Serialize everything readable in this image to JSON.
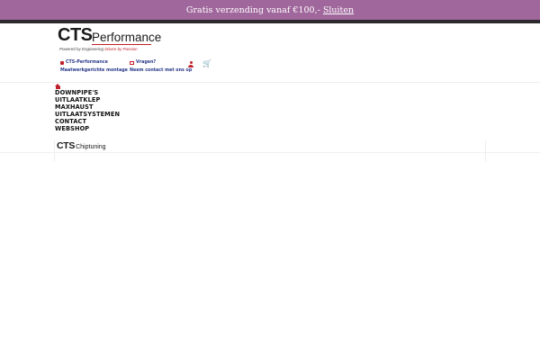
{
  "promo": {
    "text": "Gratis verzending vanaf €100,-",
    "close_label": "Sluiten"
  },
  "logo": {
    "brand": "CTS",
    "name": "Performance",
    "tagline_a": "Powered by Engineering",
    "tagline_b": "Driven by Passion"
  },
  "info1": {
    "line1": "CTS-Performance",
    "line2": "Maatwerkgerichte montage"
  },
  "info2": {
    "line1": "Vragen?",
    "line2": "Neem contact met ons op"
  },
  "icons": {
    "home": "home-icon",
    "user": "user-icon",
    "cart": "cart-icon",
    "mail": "mail-icon",
    "car": "car-icon"
  },
  "nav": {
    "items": [
      "DOWNPIPE'S",
      "UITLAATKLEP",
      "MAXHAUST",
      "UITLAATSYSTEMEN",
      "CONTACT",
      "WEBSHOP"
    ]
  },
  "chiptuning": {
    "brand": "CTS",
    "name": "Chiptuning"
  },
  "colors": {
    "promo_bg": "#a0679c",
    "accent": "#c0202a",
    "info_text": "#2a3a8a"
  }
}
